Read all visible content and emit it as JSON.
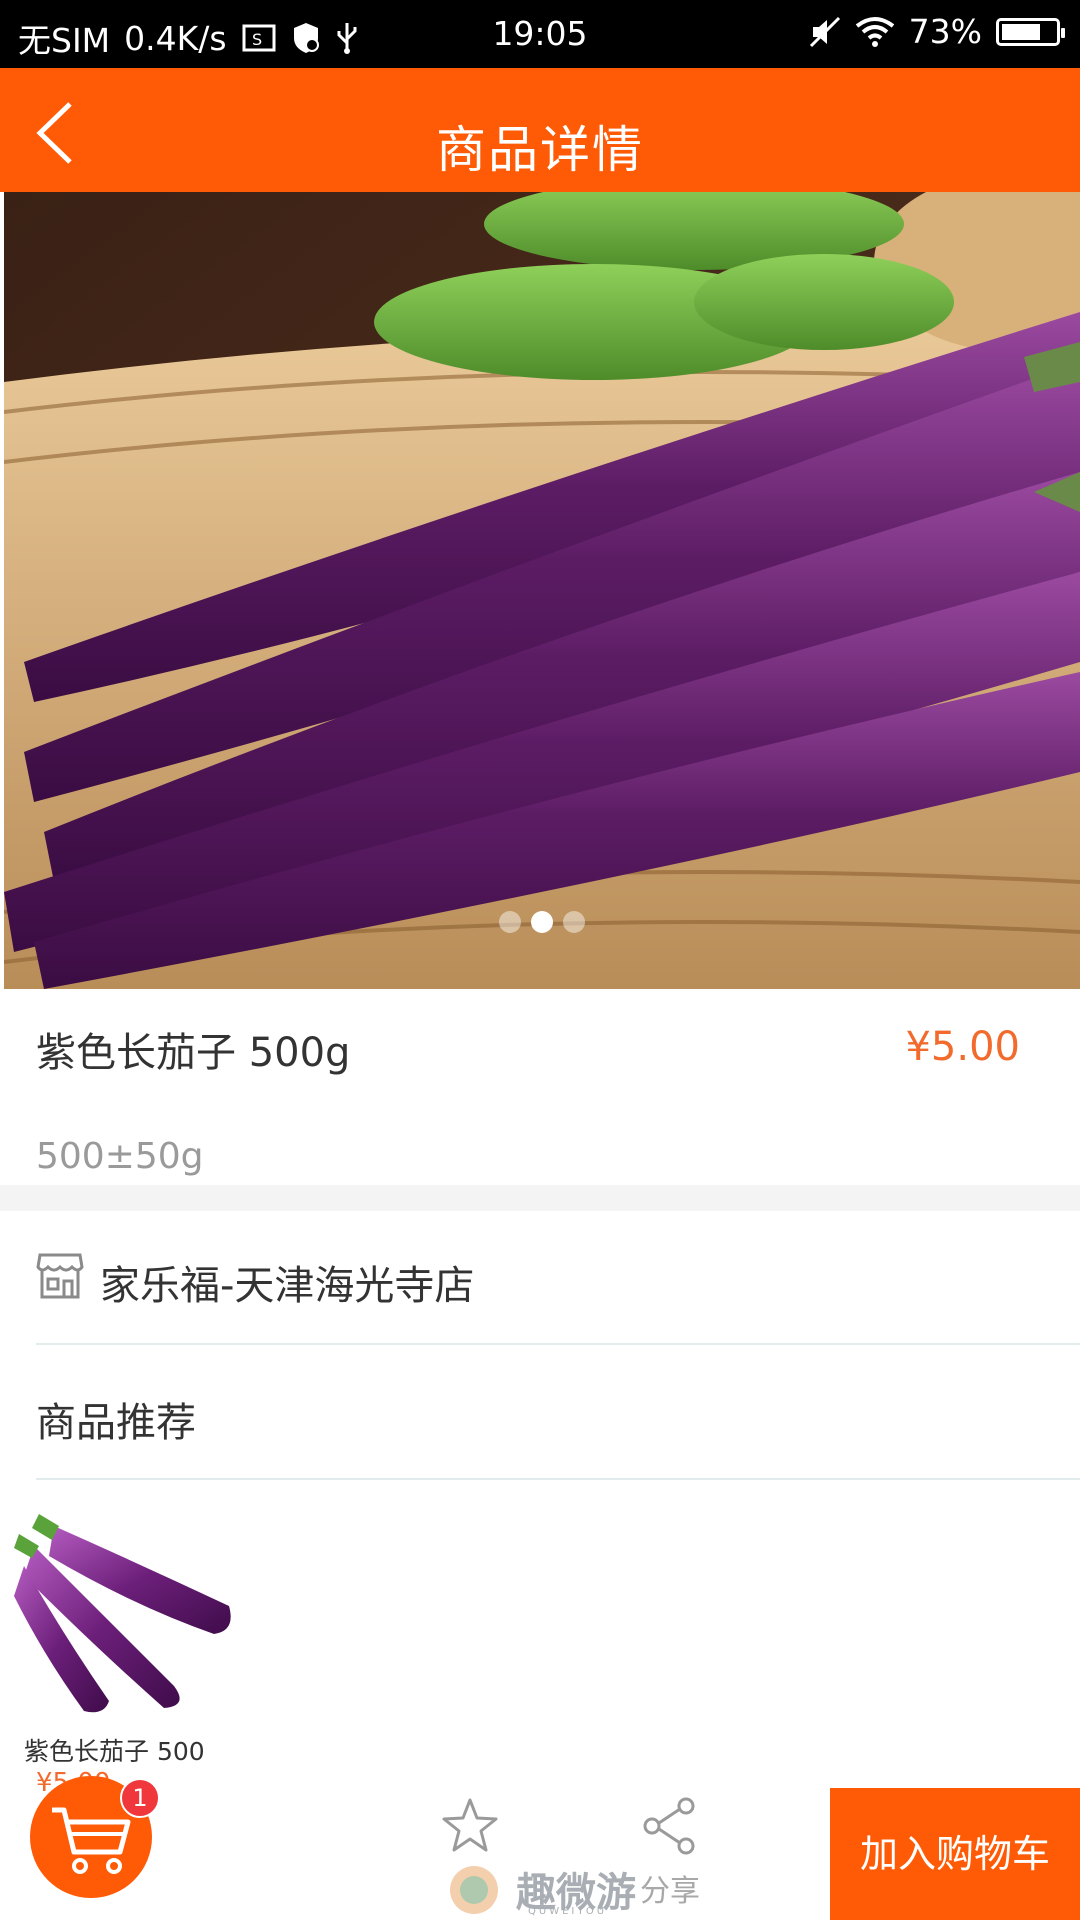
{
  "status_bar": {
    "carrier": "无SIM",
    "speed": "0.4K/s",
    "time": "19:05",
    "battery_percent": "73%",
    "battery_level": 0.73
  },
  "header": {
    "title": "商品详情",
    "back_icon": "back-chevron-icon"
  },
  "gallery": {
    "pages": 3,
    "active_page": 1
  },
  "product": {
    "name": "紫色长茄子 500g",
    "price": "¥5.00",
    "weight": "500±50g"
  },
  "store": {
    "name": "家乐福-天津海光寺店",
    "icon": "store-icon"
  },
  "recommend": {
    "title": "商品推荐",
    "items": [
      {
        "name": "紫色长茄子 500",
        "price": "¥5.00"
      }
    ]
  },
  "bottom_bar": {
    "cart_badge": "1",
    "cart_icon": "cart-icon",
    "star_icon": "star-icon",
    "share_icon": "share-icon",
    "share_label": "分享",
    "add_to_cart_label": "加入购物车"
  },
  "watermark": {
    "text": "趣微游",
    "sub": "QUWEIYOU"
  },
  "colors": {
    "brand_orange": "#ff5a05",
    "price": "#f26a2c",
    "badge": "#f0373b"
  }
}
